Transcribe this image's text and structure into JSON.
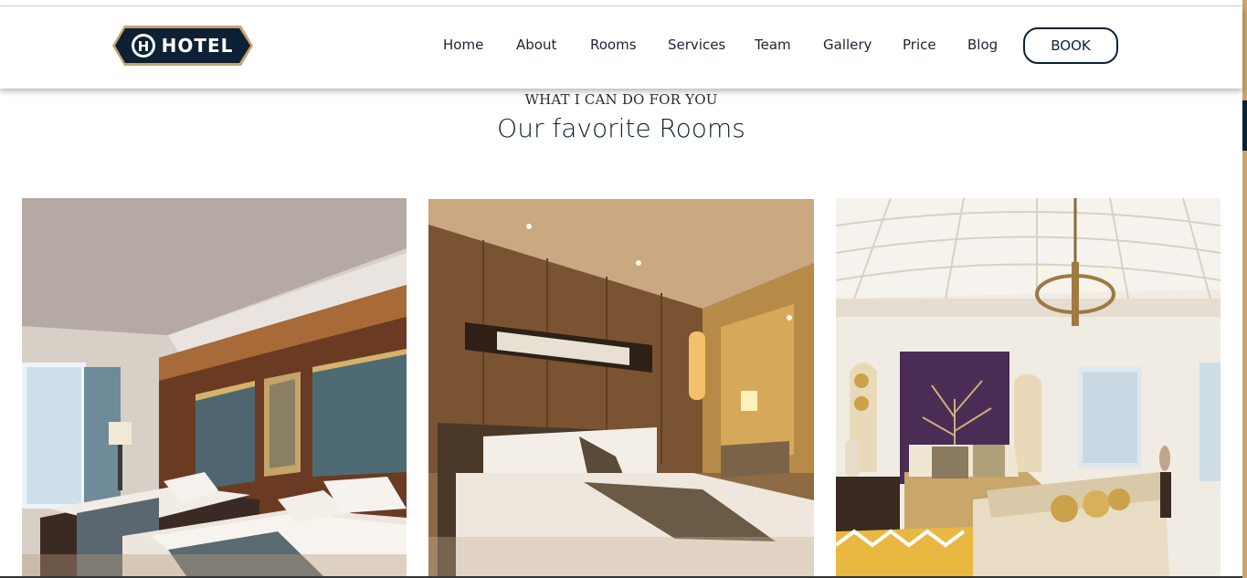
{
  "brand": {
    "logo_text": "HOTEL",
    "logo_mark": "H"
  },
  "nav": {
    "items": [
      {
        "label": "Home"
      },
      {
        "label": "About"
      },
      {
        "label": "Rooms"
      },
      {
        "label": "Services"
      },
      {
        "label": "Team"
      },
      {
        "label": "Gallery"
      },
      {
        "label": "Price"
      },
      {
        "label": "Blog"
      }
    ],
    "book_label": "BOOK"
  },
  "section": {
    "eyebrow": "WHAT I CAN DO FOR YOU",
    "title": "Our favorite Rooms"
  },
  "rooms": [
    {
      "image": "twin-bedroom-photo"
    },
    {
      "image": "king-bedroom-photo"
    },
    {
      "image": "palace-suite-photo"
    }
  ],
  "colors": {
    "navy": "#0d2035",
    "gold": "#c9a36b",
    "text": "#1c2430"
  }
}
